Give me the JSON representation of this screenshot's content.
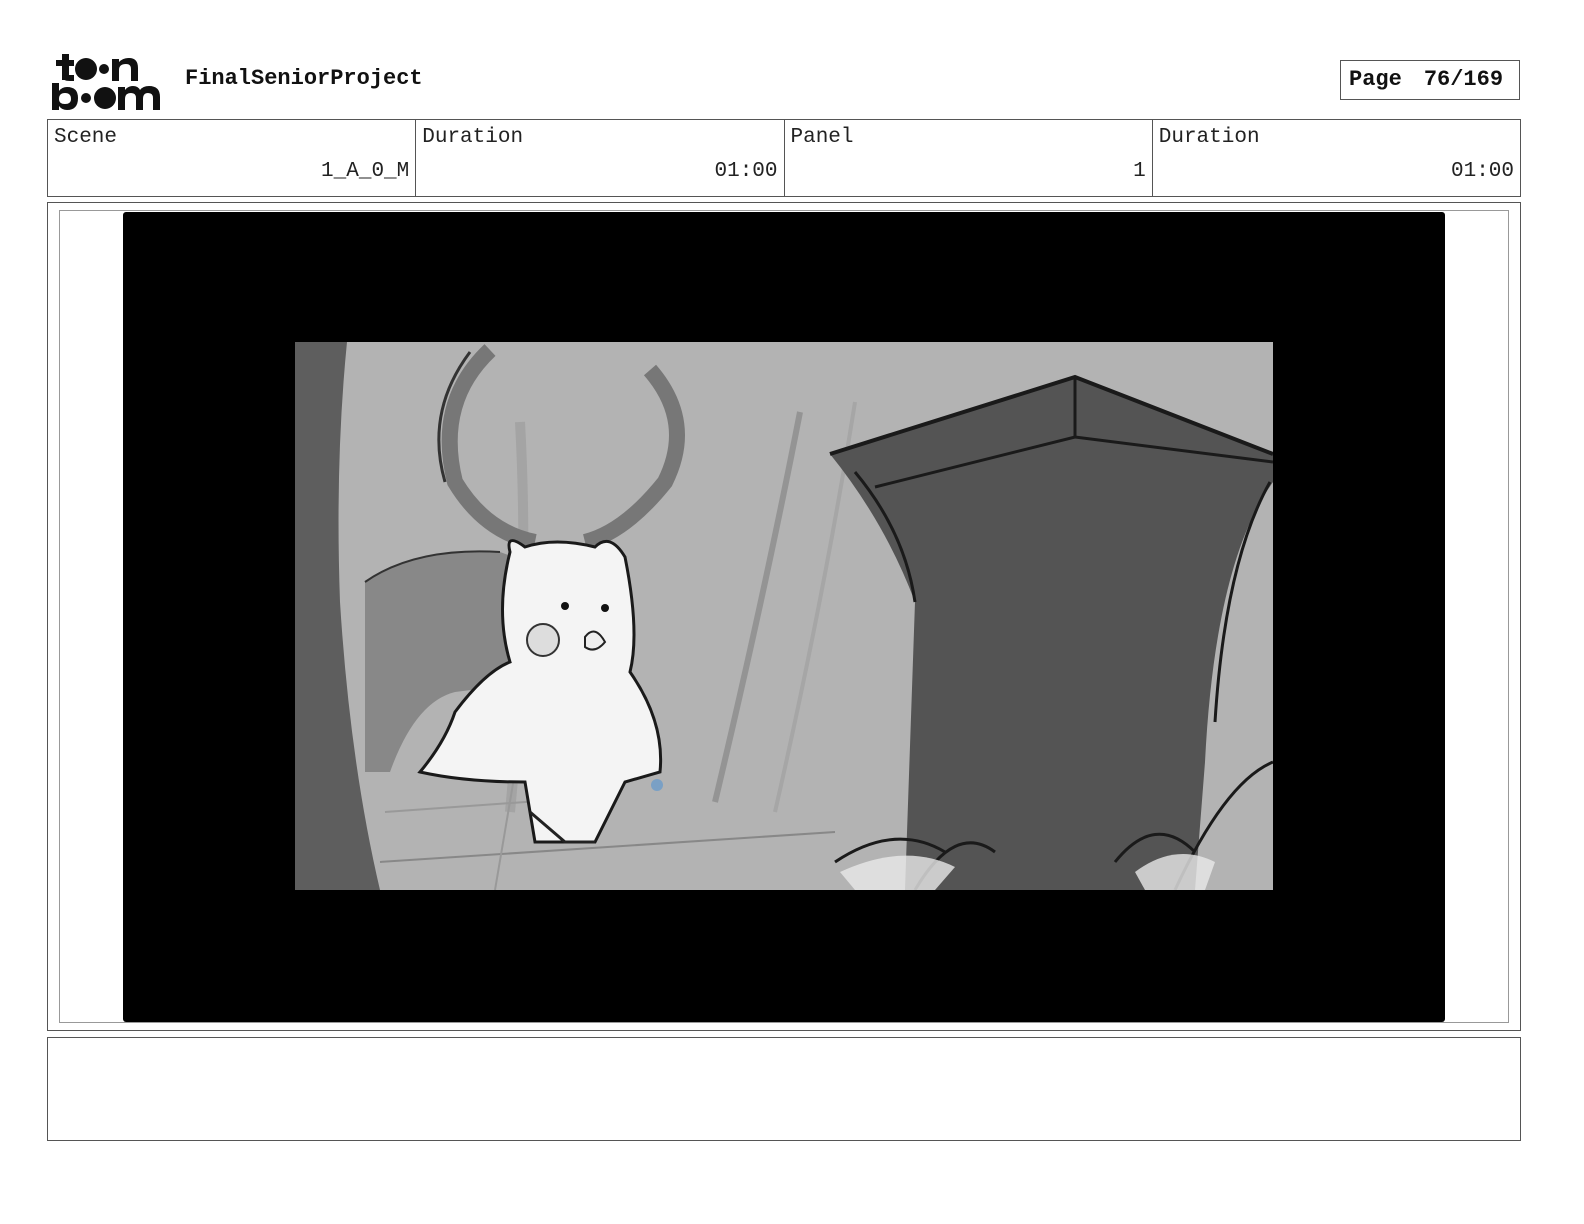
{
  "header": {
    "logo_text": "toon boom",
    "project_title": "FinalSeniorProject",
    "page_label": "Page",
    "page_number": "76/169"
  },
  "info": {
    "scene_label": "Scene",
    "scene_value": "1_A_0_M",
    "scene_duration_label": "Duration",
    "scene_duration_value": "01:00",
    "panel_label": "Panel",
    "panel_value": "1",
    "panel_duration_label": "Duration",
    "panel_duration_value": "01:00"
  },
  "notes": {
    "text": ""
  },
  "colors": {
    "letterbox": "#000000",
    "panel_bg": "#b3b3b3",
    "pillar": "#545454",
    "border": "#555555"
  }
}
